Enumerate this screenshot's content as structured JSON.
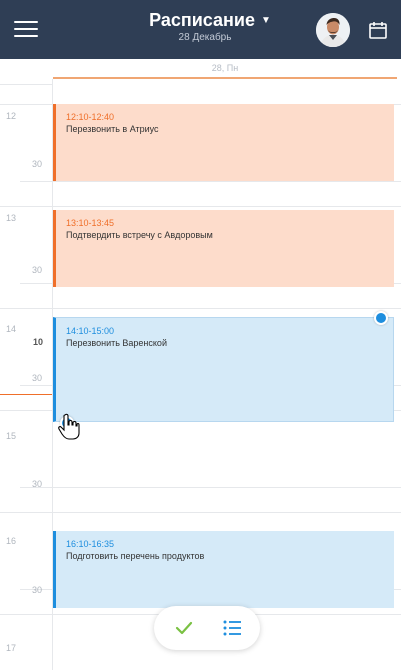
{
  "header": {
    "title": "Расписание",
    "subtitle": "28 Декабрь",
    "bg": "#2f3e55"
  },
  "day_header": "28, Пн",
  "grid": {
    "hours": [
      "12",
      "13",
      "14",
      "15",
      "16",
      "17"
    ],
    "half_label": "30",
    "current_minute": "10"
  },
  "events": [
    {
      "time": "12:10-12:40",
      "title": "Перезвонить в Атриус",
      "color": "#ef6f2a"
    },
    {
      "time": "13:10-13:45",
      "title": "Подтвердить встречу с Авдоровым",
      "color": "#ef6f2a"
    },
    {
      "time": "14:10-15:00",
      "title": "Перезвонить Варенской",
      "color": "#1e8ede"
    },
    {
      "time": "16:10-16:35",
      "title": "Подготовить перечень продуктов",
      "color": "#1e8ede"
    }
  ],
  "icons": {
    "menu": "hamburger-icon",
    "calendar": "calendar-icon",
    "check": "check-icon",
    "list": "list-icon"
  }
}
